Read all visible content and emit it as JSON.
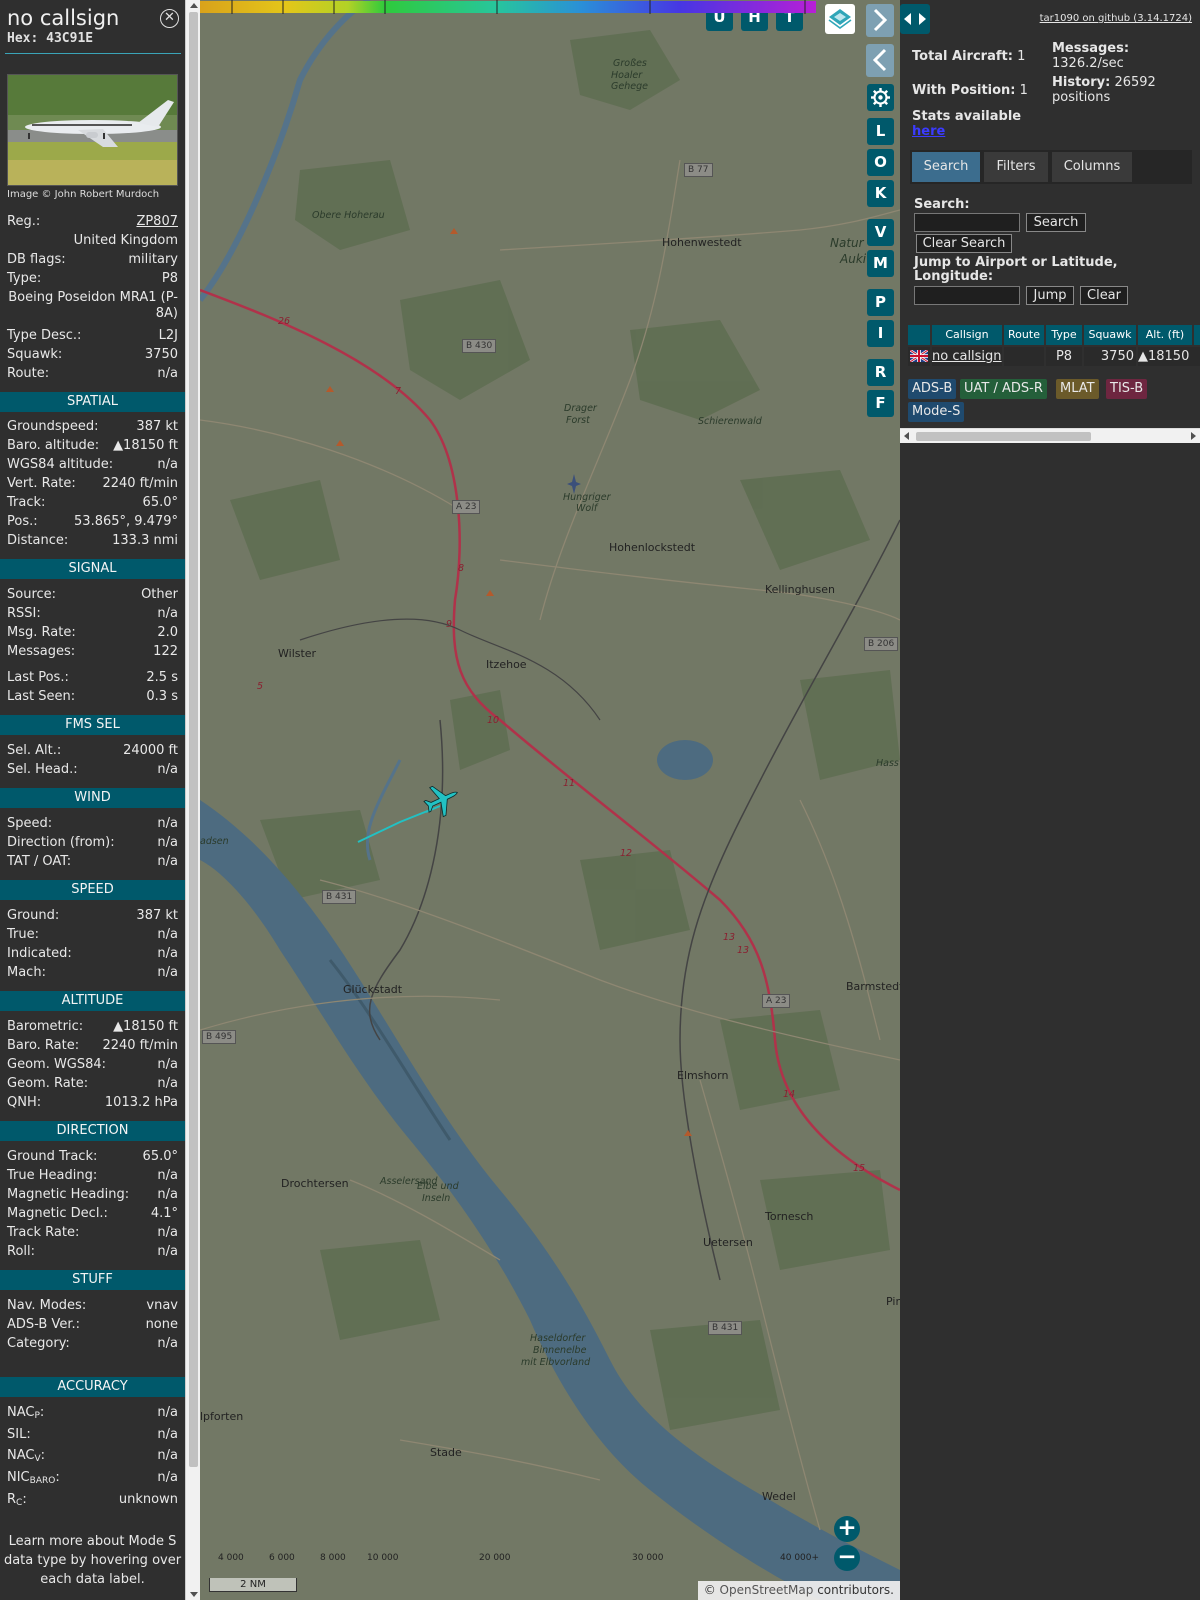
{
  "info": {
    "callsign": "no callsign",
    "hex": "Hex: 43C91E",
    "close_icon": "close-icon",
    "photo_credit": "Image © John Robert Murdoch",
    "reg_label": "Reg.:",
    "reg_value": "ZP807",
    "country": "United Kingdom",
    "dbflags_label": "DB flags:",
    "dbflags_value": "military",
    "type_label": "Type:",
    "type_value": "P8",
    "model_line1": "Boeing Poseidon MRA1 (P-",
    "model_line2": "8A)",
    "typedesc_label": "Type Desc.:",
    "typedesc_value": "L2J",
    "squawk_label": "Squawk:",
    "squawk_value": "3750",
    "route_label": "Route:",
    "route_value": "n/a",
    "sec_spatial": "SPATIAL",
    "gs_label": "Groundspeed:",
    "gs_value": "387 kt",
    "baro_label": "Baro. altitude:",
    "baro_value": "▲18150 ft",
    "wgs_label": "WGS84 altitude:",
    "wgs_value": "n/a",
    "vr_label": "Vert. Rate:",
    "vr_value": "2240 ft/min",
    "track_label": "Track:",
    "track_value": "65.0°",
    "pos_label": "Pos.:",
    "pos_value": "53.865°, 9.479°",
    "dist_label": "Distance:",
    "dist_value": "133.3 nmi",
    "sec_signal": "SIGNAL",
    "src_label": "Source:",
    "src_value": "Other",
    "rssi_label": "RSSI:",
    "rssi_value": "n/a",
    "msgrate_label": "Msg. Rate:",
    "msgrate_value": "2.0",
    "msgs_label": "Messages:",
    "msgs_value": "122",
    "lastpos_label": "Last Pos.:",
    "lastpos_value": "2.5 s",
    "lastseen_label": "Last Seen:",
    "lastseen_value": "0.3 s",
    "sec_fms": "FMS SEL",
    "selalt_label": "Sel. Alt.:",
    "selalt_value": "24000 ft",
    "selhead_label": "Sel. Head.:",
    "selhead_value": "n/a",
    "sec_wind": "WIND",
    "wspeed_label": "Speed:",
    "wspeed_value": "n/a",
    "wdir_label": "Direction (from):",
    "wdir_value": "n/a",
    "tat_label": "TAT / OAT:",
    "tat_value": "n/a",
    "sec_speed": "SPEED",
    "ground_label": "Ground:",
    "ground_value": "387 kt",
    "true_label": "True:",
    "true_value": "n/a",
    "ind_label": "Indicated:",
    "ind_value": "n/a",
    "mach_label": "Mach:",
    "mach_value": "n/a",
    "sec_alt": "ALTITUDE",
    "barom_label": "Barometric:",
    "barom_value": "▲18150 ft",
    "barorate_label": "Baro. Rate:",
    "barorate_value": "2240 ft/min",
    "geomw_label": "Geom. WGS84:",
    "geomw_value": "n/a",
    "geomr_label": "Geom. Rate:",
    "geomr_value": "n/a",
    "qnh_label": "QNH:",
    "qnh_value": "1013.2 hPa",
    "sec_dir": "DIRECTION",
    "gt_label": "Ground Track:",
    "gt_value": "65.0°",
    "th_label": "True Heading:",
    "th_value": "n/a",
    "mh_label": "Magnetic Heading:",
    "mh_value": "n/a",
    "md_label": "Magnetic Decl.:",
    "md_value": "4.1°",
    "tr_label": "Track Rate:",
    "tr_value": "n/a",
    "roll_label": "Roll:",
    "roll_value": "n/a",
    "sec_stuff": "STUFF",
    "nav_label": "Nav. Modes:",
    "nav_value": "vnav",
    "adsbv_label": "ADS-B Ver.:",
    "adsbv_value": "none",
    "cat_label": "Category:",
    "cat_value": "n/a",
    "sec_acc": "ACCURACY",
    "nacp_label": "NAC",
    "nacp_sub": "P",
    "nacp_value": "n/a",
    "sil_label": "SIL:",
    "sil_value": "n/a",
    "nacv_label": "NAC",
    "nacv_sub": "V",
    "nacv_value": "n/a",
    "nic_label": "NIC",
    "nic_sub": "BARO",
    "nic_value": "n/a",
    "rc_label": "R",
    "rc_sub": "C",
    "rc_value": "unknown",
    "learn_1": "Learn more about Mode S",
    "learn_2": "data type by hovering over",
    "learn_3": "each data label."
  },
  "map": {
    "buttons_top": [
      "U",
      "H",
      "T"
    ],
    "buttons_side": [
      "L",
      "O",
      "K",
      "V",
      "M",
      "P",
      "I",
      "R",
      "F"
    ],
    "labels": {
      "grosses": "Großes",
      "hoaler": "Hoaler",
      "gehege": "Gehege",
      "obere": "Obere Hoherau",
      "hohenwestedt": "Hohenwestedt",
      "natur": "Natur",
      "auki": "Auki",
      "drager": "Drager",
      "forst": "Forst",
      "schierenwald": "Schierenwald",
      "hungriger": "Hungriger",
      "wolf": "Wolf",
      "hohenlockstedt": "Hohenlockstedt",
      "kellinghusen": "Kellinghusen",
      "wilster": "Wilster",
      "itzehoe": "Itzehoe",
      "hass": "Hass",
      "gluckstadt": "Glückstadt",
      "barmstedt": "Barmstedt",
      "elmshorn": "Elmshorn",
      "drochtersen": "Drochtersen",
      "asselersand": "Asselersand",
      "elbe1": "Elbe und",
      "elbe2": "Inseln",
      "tornesch": "Tornesch",
      "uetersen": "Uetersen",
      "pin": "Pin",
      "hasel1": "Haseldorfer",
      "hasel2": "Binnenelbe",
      "hasel3": "mit Elbvorland",
      "lpforten": "lpforten",
      "stade": "Stade",
      "wedel": "Wedel",
      "adsen": "adsen"
    },
    "roads": {
      "b77": "B 77",
      "b430": "B 430",
      "a23a": "A 23",
      "b206": "B 206",
      "b431a": "B 431",
      "a23b": "A 23",
      "b495": "B 495",
      "b431b": "B 431"
    },
    "km": {
      "k26": "26",
      "k7": "7",
      "k8": "8",
      "k9": "9",
      "k10": "10",
      "k11": "11",
      "k12": "12",
      "k13a": "13",
      "k13b": "13",
      "k14": "14",
      "k15": "15",
      "k5": "5"
    },
    "alt_ticks": [
      "4 000",
      "6 000",
      "8 000",
      "10 000",
      "20 000",
      "30 000",
      "40 000+"
    ],
    "scale": "2 NM",
    "osm_prefix": "© ",
    "osm_link": "OpenStreetMap",
    "osm_suffix": " contributors.",
    "zoom_in": "+",
    "zoom_out": "−"
  },
  "side": {
    "github": "tar1090 on github (3.14.1724)",
    "total_label": "Total Aircraft:",
    "total_value": "1",
    "withpos_label": "With Position:",
    "withpos_value": "1",
    "msgs_label": "Messages:",
    "msgs_value": "1326.2/sec",
    "hist_label": "History:",
    "hist_value": "26592",
    "hist_unit": "positions",
    "stats_label": "Stats available",
    "stats_link": "here",
    "tabs": [
      "Search",
      "Filters",
      "Columns"
    ],
    "search_label": "Search:",
    "search_btn": "Search",
    "clear_search_btn": "Clear Search",
    "jump_label": "Jump to Airport or Latitude,",
    "jump_label2": "Longitude:",
    "jump_btn": "Jump",
    "clear_btn": "Clear",
    "columns": [
      "Callsign",
      "Route",
      "Type",
      "Squawk",
      "Alt. (ft)"
    ],
    "row": {
      "callsign": "no callsign",
      "route": "",
      "type": "P8",
      "squawk": "3750",
      "alt": "▲18150"
    },
    "sources": [
      "ADS-B",
      "UAT / ADS-R",
      "MLAT",
      "TIS-B",
      "Mode-S"
    ]
  },
  "colors": {
    "accent": "#00596b",
    "panel_bg": "#2f2f2f",
    "track": "#22c1c3",
    "adsb": "#1f4a6e",
    "uat": "#245f3a",
    "mlat": "#6b5a2a",
    "tisb": "#6e2640",
    "modes": "#1f4a6e"
  }
}
